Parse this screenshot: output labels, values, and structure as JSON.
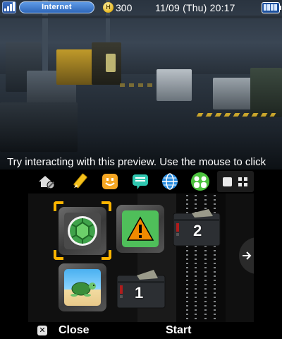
{
  "status_bar": {
    "connection_label": "Internet",
    "coin_symbol": "H",
    "coin_count": "300",
    "datetime": "11/09 (Thu) 20:17",
    "signal_bars": 4,
    "battery_level": 1.0
  },
  "preview_hint": "Try interacting with this preview. Use the mouse to click",
  "app_bar": {
    "icons": [
      "home-settings-icon",
      "pencil-icon",
      "smiley-face-icon",
      "speech-bubble-icon",
      "globe-icon",
      "friends-icon"
    ],
    "view_toggles": [
      "single-view-icon",
      "grid-view-icon"
    ]
  },
  "tiles": [
    {
      "name": "green-shell-app",
      "icon": "green-shell-icon",
      "selected": true
    },
    {
      "name": "warning-app",
      "icon": "warning-icon",
      "selected": false
    },
    {
      "name": "folder-2",
      "icon": "folder-icon",
      "label": "2"
    },
    {
      "name": "turtle-beach-app",
      "icon": "turtle-icon",
      "selected": false
    },
    {
      "name": "folder-1",
      "icon": "folder-icon",
      "label": "1"
    }
  ],
  "bottom_bar": {
    "close_icon_glyph": "✕",
    "close_label": "Close",
    "start_label": "Start"
  },
  "colors": {
    "cursor": "#ffb400",
    "status_blue": "#2d66b9",
    "warning_green": "#4fbf5a",
    "warning_orange": "#f08a00"
  }
}
